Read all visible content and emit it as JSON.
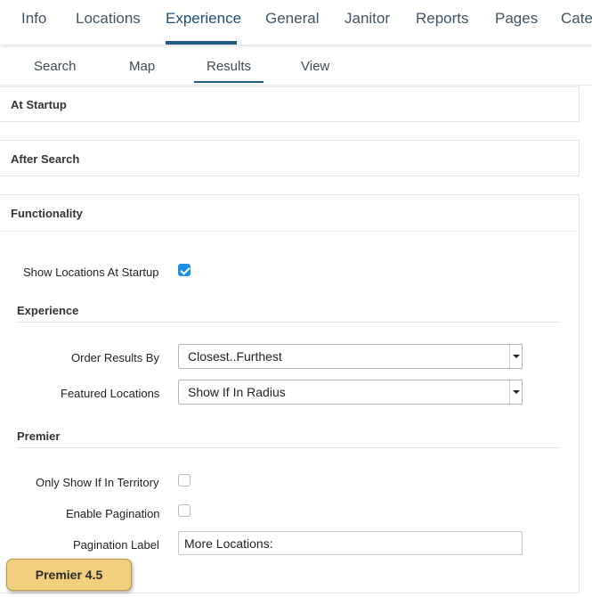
{
  "topnav": {
    "tabs": [
      "Info",
      "Locations",
      "Experience",
      "General",
      "Janitor",
      "Reports",
      "Pages",
      "Categ"
    ],
    "active": "Experience"
  },
  "subnav": {
    "tabs": [
      "Search",
      "Map",
      "Results",
      "View"
    ],
    "active": "Results"
  },
  "panels": {
    "at_startup": "At Startup",
    "after_search": "After Search",
    "functionality": "Functionality"
  },
  "form": {
    "show_locations_label": "Show Locations At Startup",
    "show_locations_checked": true,
    "experience_heading": "Experience",
    "order_results_label": "Order Results By",
    "order_results_value": "Closest..Furthest",
    "featured_label": "Featured Locations",
    "featured_value": "Show If In Radius",
    "premier_heading": "Premier",
    "territory_label": "Only Show If In Territory",
    "territory_checked": false,
    "pagination_label": "Enable Pagination",
    "pagination_checked": false,
    "pagination_text_label": "Pagination Label",
    "pagination_text_value": "More Locations:"
  },
  "badge": {
    "label": "Premier 4.5",
    "color": "#f0d07e"
  },
  "colors": {
    "accent": "#1f5a82",
    "checkbox": "#1a8fe3"
  }
}
